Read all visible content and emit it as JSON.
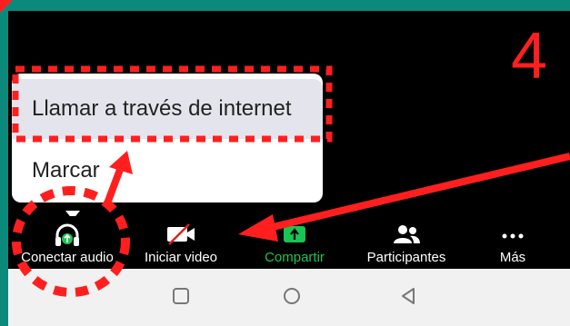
{
  "annotation": {
    "step_number": "4",
    "color": "#ff1f1f"
  },
  "popup_menu": {
    "items": [
      {
        "label": "Llamar a través de internet"
      },
      {
        "label": "Marcar"
      }
    ]
  },
  "toolbar": {
    "items": [
      {
        "label": "Conectar audio",
        "icon": "headphones-icon"
      },
      {
        "label": "Iniciar video",
        "icon": "video-off-icon"
      },
      {
        "label": "Compartir",
        "icon": "share-screen-icon",
        "color": "#19c553"
      },
      {
        "label": "Participantes",
        "icon": "participants-icon"
      },
      {
        "label": "Más",
        "icon": "more-icon"
      }
    ]
  },
  "nav_bar": {
    "buttons": [
      "recents-button",
      "home-button",
      "back-button"
    ]
  }
}
